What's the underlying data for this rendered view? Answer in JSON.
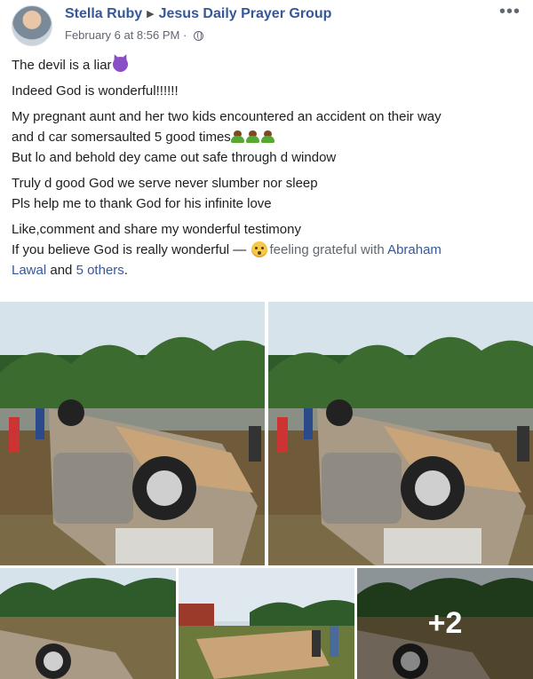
{
  "post": {
    "author": "Stella Ruby",
    "group": "Jesus Daily Prayer Group",
    "timestamp": "February 6 at 8:56 PM",
    "more_label": "•••",
    "icons": {
      "audience": "globe-icon",
      "more": "more-options-icon",
      "arrow": "right-triangle-icon"
    }
  },
  "body": {
    "line1": "The devil is a liar",
    "line2": "Indeed God is wonderful!!!!!!",
    "line3a": "My pregnant aunt and her two kids encountered an accident on their way",
    "line3b": "and d car somersaulted 5 good times",
    "line3c": "But lo and behold dey came out safe through d window",
    "line4a": "Truly d good God we serve never slumber nor sleep",
    "line4b": "Pls help me to thank God for his infinite love",
    "line5a": "Like,comment and share my wonderful testimony",
    "line5b": "If you believe God is really wonderful —",
    "feeling": "feeling grateful with",
    "tag_person": "Abraham Lawal",
    "tag_person_part1": "Abraham",
    "tag_person_part2": "Lawal",
    "and_text": "and",
    "others": "5 others",
    "period": "."
  },
  "photos": {
    "more_count": "+2",
    "items": [
      {
        "name": "photo-1",
        "content": "overturned car"
      },
      {
        "name": "photo-2",
        "content": "overturned car"
      },
      {
        "name": "photo-3",
        "content": "overturned car"
      },
      {
        "name": "photo-4",
        "content": "overturned car"
      },
      {
        "name": "photo-5",
        "content": "overturned car"
      }
    ]
  }
}
